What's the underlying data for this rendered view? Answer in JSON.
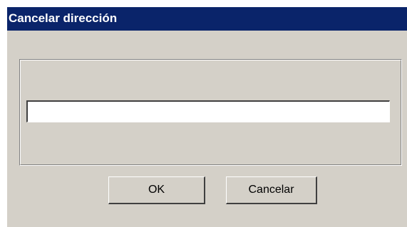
{
  "window": {
    "title": "Cancelar dirección"
  },
  "form": {
    "address_value": ""
  },
  "buttons": {
    "ok_label": "OK",
    "cancel_label": "Cancelar"
  },
  "colors": {
    "titlebar": "#0a246a",
    "face": "#d4d0c8"
  }
}
